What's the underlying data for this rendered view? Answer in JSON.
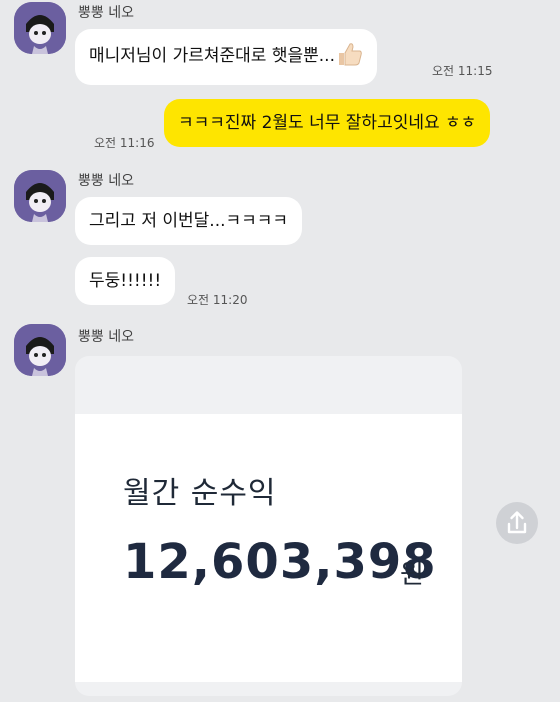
{
  "messages": [
    {
      "sender": "뿡뿡 네오",
      "text": "매니저님이 가르쳐준대로 햇을뿐...",
      "time": "오전 11:15"
    },
    {
      "sender": "me",
      "text": "ㅋㅋㅋ진짜 2월도 너무 잘하고잇네요 ㅎㅎ",
      "time": "오전 11:16"
    },
    {
      "sender": "뿡뿡 네오",
      "text": "그리고 저 이번달...ㅋㅋㅋㅋ"
    },
    {
      "sender": "뿡뿡 네오",
      "text": "두둥!!!!!!",
      "time": "오전 11:20"
    },
    {
      "sender": "뿡뿡 네오"
    }
  ],
  "card": {
    "label": "월간 순수익",
    "amount": "12,603,398",
    "unit": "원"
  },
  "icons": {
    "avatar": "character-avatar-icon",
    "thumb": "thumbs-up-icon",
    "share": "share-icon"
  },
  "colors": {
    "background": "#e8e9eb",
    "my_bubble": "#fee500",
    "other_bubble": "#ffffff",
    "avatar_bg": "#6b5fa0"
  }
}
